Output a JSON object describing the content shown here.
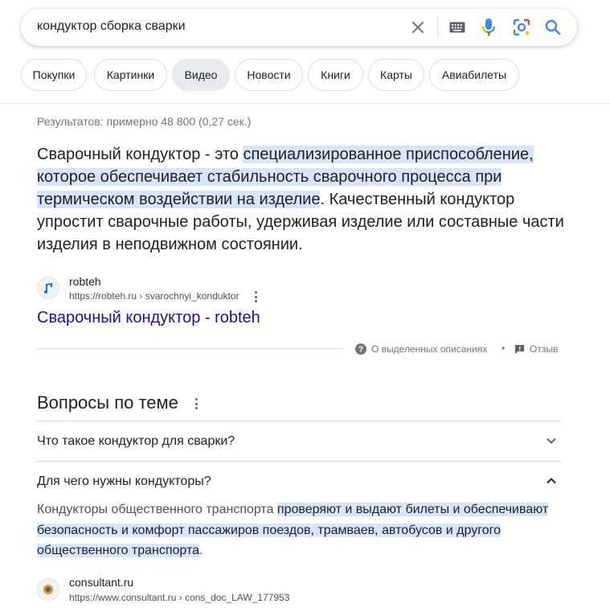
{
  "search": {
    "query": "кондуктор сборка сварки"
  },
  "icons": {
    "clear": "close-icon",
    "keyboard": "keyboard-icon",
    "voice": "microphone-icon",
    "lens": "camera-lens-icon",
    "search": "search-icon"
  },
  "chips": [
    "Покупки",
    "Картинки",
    "Видео",
    "Новости",
    "Книги",
    "Карты",
    "Авиабилеты"
  ],
  "results_count": "Результатов: примерно 48 800 (0,27 сек.)",
  "featured": {
    "text_plain_1": "Сварочный кондуктор - это ",
    "text_hl_1": "специализированное приспособление, которое обеспечивает стабильность сварочного процесса при термическом воздействии на изделие",
    "text_plain_2": ". Качественный кондуктор упростит сварочные работы, удерживая изделие или составные части изделия в неподвижном состоянии.",
    "source_name": "robteh",
    "source_url": "https://robteh.ru › svarochnyi_konduktor",
    "link_title": "Сварочный кондуктор - robteh",
    "about_label": "О выделенных описаниях",
    "separator": "•",
    "feedback_label": "Отзыв"
  },
  "paa": {
    "title": "Вопросы по теме",
    "questions": [
      "Что такое кондуктор для сварки?",
      "Для чего нужны кондукторы?"
    ],
    "answer_plain_1": "Кондукторы общественного транспорта ",
    "answer_hl_1": "проверяют и выдают билеты и обеспечивают безопасность и комфорт пассажиров поездов, трамваев, автобусов и другого общественного транспорта",
    "answer_plain_2": ".",
    "answer_source_name": "consultant.ru",
    "answer_source_url": "https://www.consultant.ru › cons_doc_LAW_177953"
  },
  "colors": {
    "link": "#1a0dab",
    "highlight": "#d3e3fd",
    "muted": "#70757a",
    "mic_blue": "#4285f4",
    "mic_red": "#ea4335",
    "mic_yellow": "#fbbc04",
    "mic_green": "#34a853"
  }
}
